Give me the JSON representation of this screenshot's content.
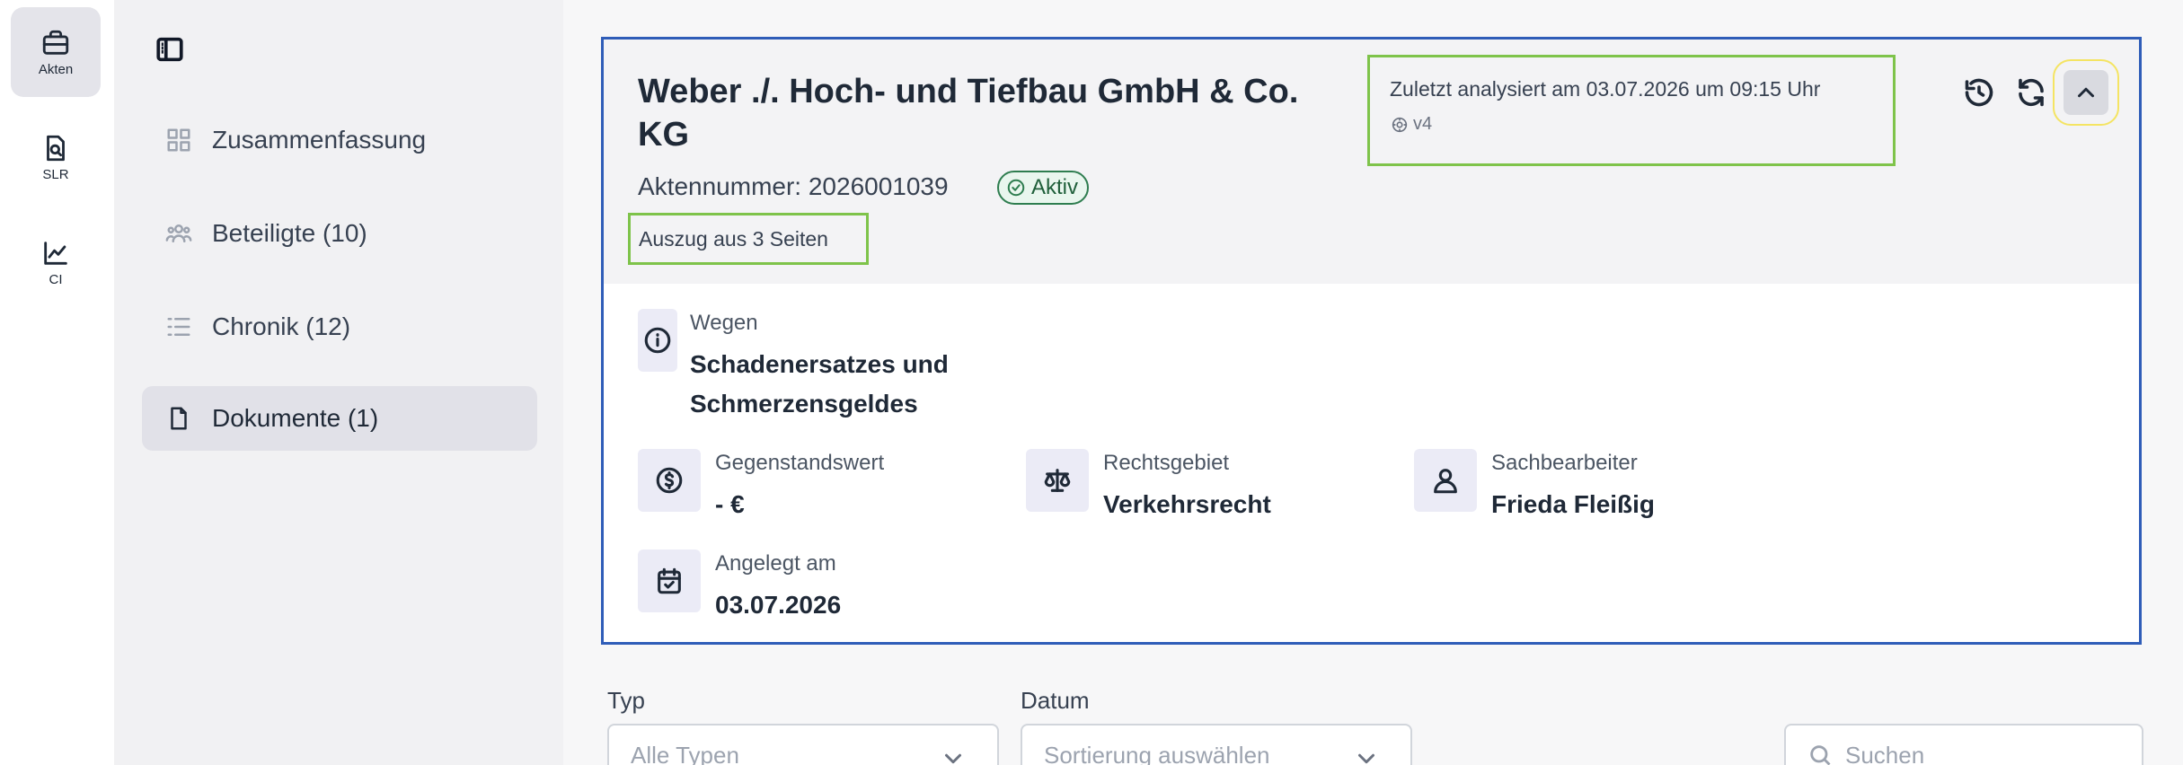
{
  "rail": {
    "items": [
      {
        "label": "Akten",
        "icon": "briefcase-icon",
        "active": true
      },
      {
        "label": "SLR",
        "icon": "document-search-icon",
        "active": false
      },
      {
        "label": "CI",
        "icon": "line-chart-icon",
        "active": false
      }
    ]
  },
  "sidebar": {
    "toggle_icon": "sidebar-toggle-icon",
    "items": [
      {
        "label": "Zusammenfassung",
        "icon": "grid-icon",
        "active": false
      },
      {
        "label": "Beteiligte (10)",
        "icon": "users-icon",
        "active": false
      },
      {
        "label": "Chronik (12)",
        "icon": "list-icon",
        "active": false
      },
      {
        "label": "Dokumente (1)",
        "icon": "file-icon",
        "active": true
      }
    ]
  },
  "case": {
    "title": "Weber ./. Hoch- und Tiefbau GmbH & Co. KG",
    "file_number": "Aktennummer: 2026001039",
    "status": "Aktiv",
    "excerpt": "Auszug aus 3 Seiten",
    "analysis_text": "Zuletzt analysiert am 03.07.2026 um 09:15 Uhr",
    "version": "v4",
    "fields": {
      "wegen": {
        "label": "Wegen",
        "value": "Schadenersatzes und Schmerzensgeldes"
      },
      "gegenstandswert": {
        "label": "Gegenstandswert",
        "value": "- €"
      },
      "rechtsgebiet": {
        "label": "Rechtsgebiet",
        "value": "Verkehrsrecht"
      },
      "sachbearbeiter": {
        "label": "Sachbearbeiter",
        "value": "Frieda Fleißig"
      },
      "angelegt": {
        "label": "Angelegt am",
        "value": "03.07.2026"
      }
    }
  },
  "filters": {
    "typ_label": "Typ",
    "typ_placeholder": "Alle Typen",
    "datum_label": "Datum",
    "datum_placeholder": "Sortierung auswählen",
    "search_placeholder": "Suchen"
  },
  "colors": {
    "accent_border": "#2f5db8",
    "highlight_green": "#7ec34a",
    "status_green": "#2e7d4f"
  }
}
